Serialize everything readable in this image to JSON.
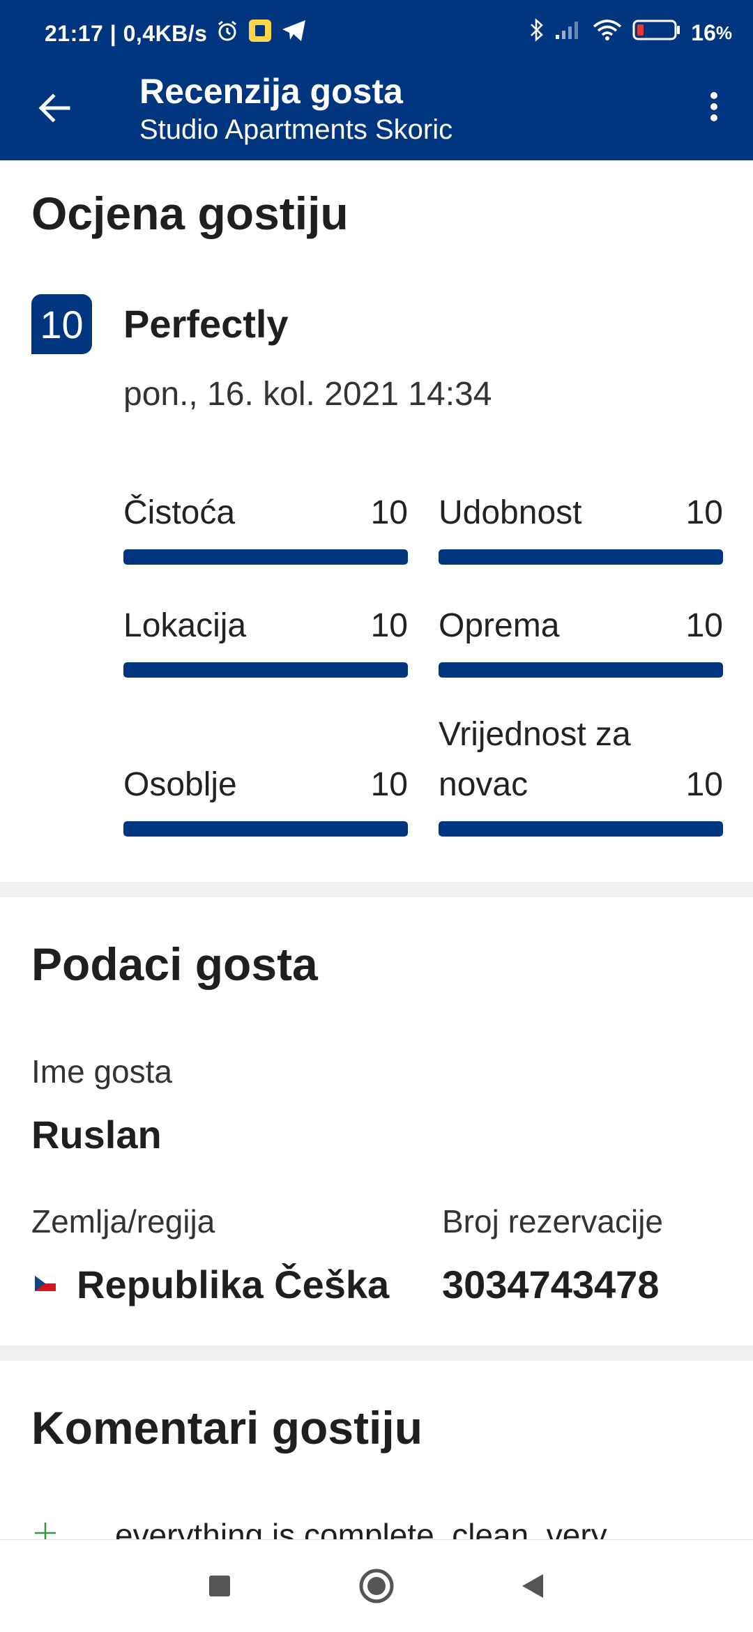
{
  "status_bar": {
    "time": "21:17",
    "speed": "0,4KB/s",
    "battery": "16",
    "battery_pct_unit": "%",
    "icons": [
      "alarm-icon",
      "notification-app-icon",
      "telegram-icon",
      "bluetooth-icon",
      "signal-icon",
      "wifi-icon",
      "battery-icon"
    ]
  },
  "app_bar": {
    "title": "Recenzija gosta",
    "subtitle": "Studio Apartments Skoric",
    "back_icon": "arrow-left-icon",
    "menu_icon": "more-vertical-icon",
    "color": "#003580"
  },
  "rating": {
    "section_title": "Ocjena gostiju",
    "score": "10",
    "score_word": "Perfectly",
    "date": "pon., 16. kol. 2021 14:34",
    "metrics": [
      {
        "label": "Čistoća",
        "value": "10",
        "fill": 1.0
      },
      {
        "label": "Udobnost",
        "value": "10",
        "fill": 1.0
      },
      {
        "label": "Lokacija",
        "value": "10",
        "fill": 1.0
      },
      {
        "label": "Oprema",
        "value": "10",
        "fill": 1.0
      },
      {
        "label": "Osoblje",
        "value": "10",
        "fill": 1.0
      },
      {
        "label": "Vrijednost za novac",
        "value": "10",
        "fill": 1.0
      }
    ]
  },
  "guest": {
    "section_title": "Podaci gosta",
    "name_label": "Ime gosta",
    "name": "Ruslan",
    "country_label": "Zemlja/regija",
    "country": "Republika Češka",
    "country_flag": "czech-flag-icon",
    "booking_label": "Broj rezervacije",
    "booking_number": "3034743478"
  },
  "comments": {
    "section_title": "Komentari gostiju",
    "positive_icon": "plus-icon",
    "positive_text": "everything is complete, clean, very"
  },
  "nav_bar": {
    "icons": [
      "recents-square-icon",
      "home-circle-icon",
      "back-triangle-icon"
    ]
  }
}
